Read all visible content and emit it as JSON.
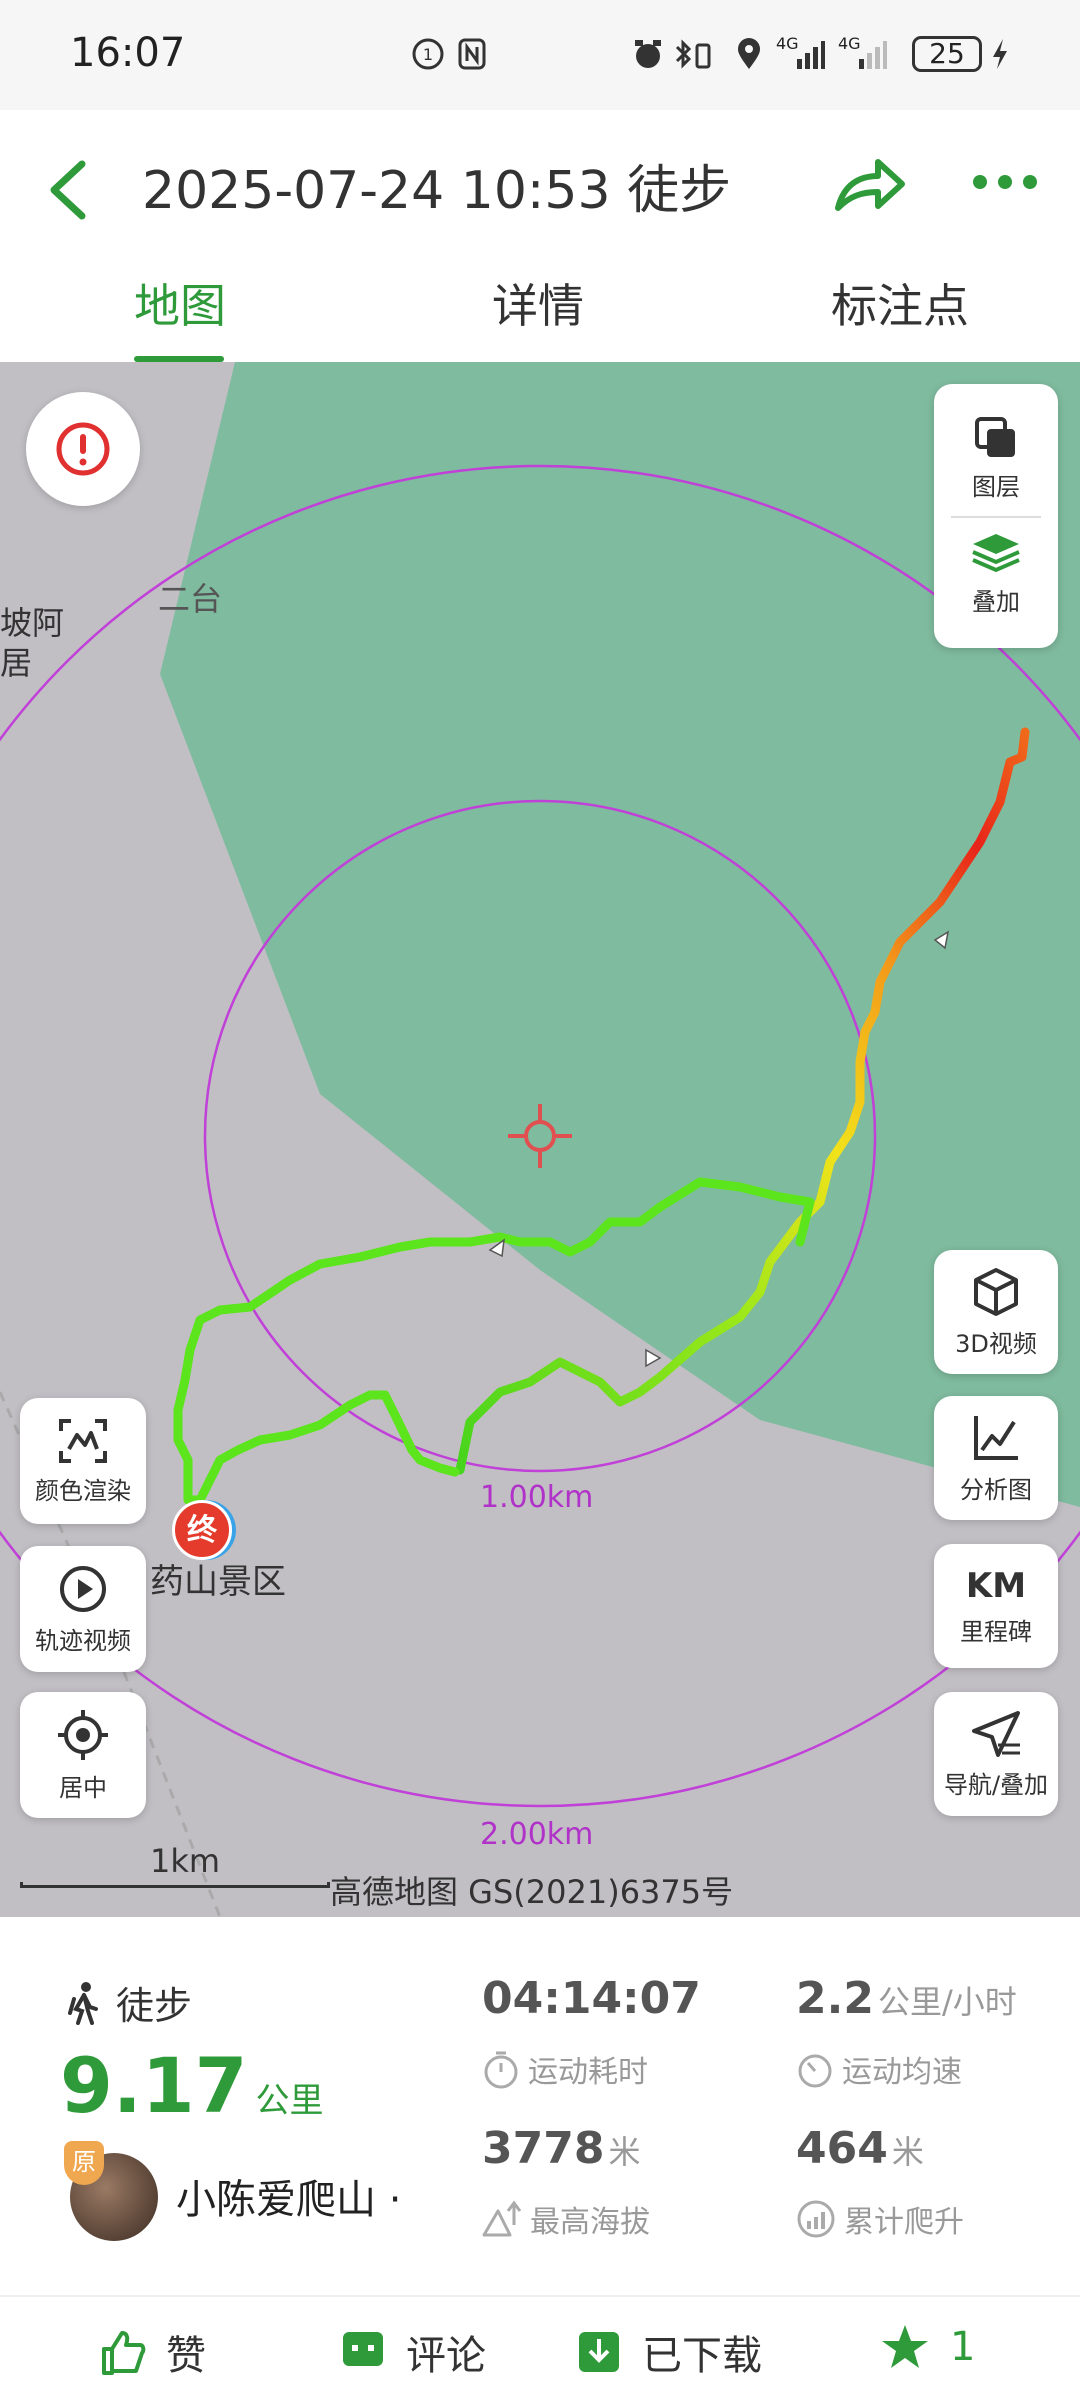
{
  "status_bar": {
    "time": "16:07",
    "battery": "25",
    "network_1": "4G",
    "network_2": "4G"
  },
  "header": {
    "title": "2025-07-24 10:53 徒步",
    "back_icon": "chevron-left-icon",
    "share_icon": "share-arrow-icon",
    "more_icon": "more-dots-icon",
    "accent_color": "#2f9a3a"
  },
  "tabs": [
    {
      "label": "地图",
      "active": true
    },
    {
      "label": "详情",
      "active": false
    },
    {
      "label": "标注点",
      "active": false
    }
  ],
  "map": {
    "place_labels": [
      "二台",
      "坡阿",
      "居",
      "药山景区"
    ],
    "ring_labels": [
      "1.00km",
      "2.00km"
    ],
    "end_marker": "终",
    "scale_label": "1km",
    "copyright": "高德地图 GS(2021)6375号",
    "right_controls": {
      "layers": "图层",
      "overlay": "叠加",
      "video3d": "3D视频",
      "analysis": "分析图",
      "km_icon_text": "KM",
      "milestones": "里程碑",
      "navigate": "导航/叠加"
    },
    "left_controls": {
      "color_render": "颜色渲染",
      "track_video": "轨迹视频",
      "center": "居中"
    }
  },
  "stats": {
    "activity_type": "徒步",
    "distance_value": "9.17",
    "distance_unit": "公里",
    "avatar_badge": "原",
    "username": "小陈爱爬山 ·",
    "duration": "04:14:07",
    "duration_label": "运动耗时",
    "avg_speed": "2.2",
    "avg_speed_unit": "公里/小时",
    "avg_speed_label": "运动均速",
    "max_altitude": "3778",
    "max_altitude_unit": "米",
    "max_altitude_label": "最高海拔",
    "total_climb": "464",
    "total_climb_unit": "米",
    "total_climb_label": "累计爬升"
  },
  "bottom_bar": {
    "like": "赞",
    "comment": "评论",
    "downloaded": "已下载",
    "favorite_count": "1"
  }
}
